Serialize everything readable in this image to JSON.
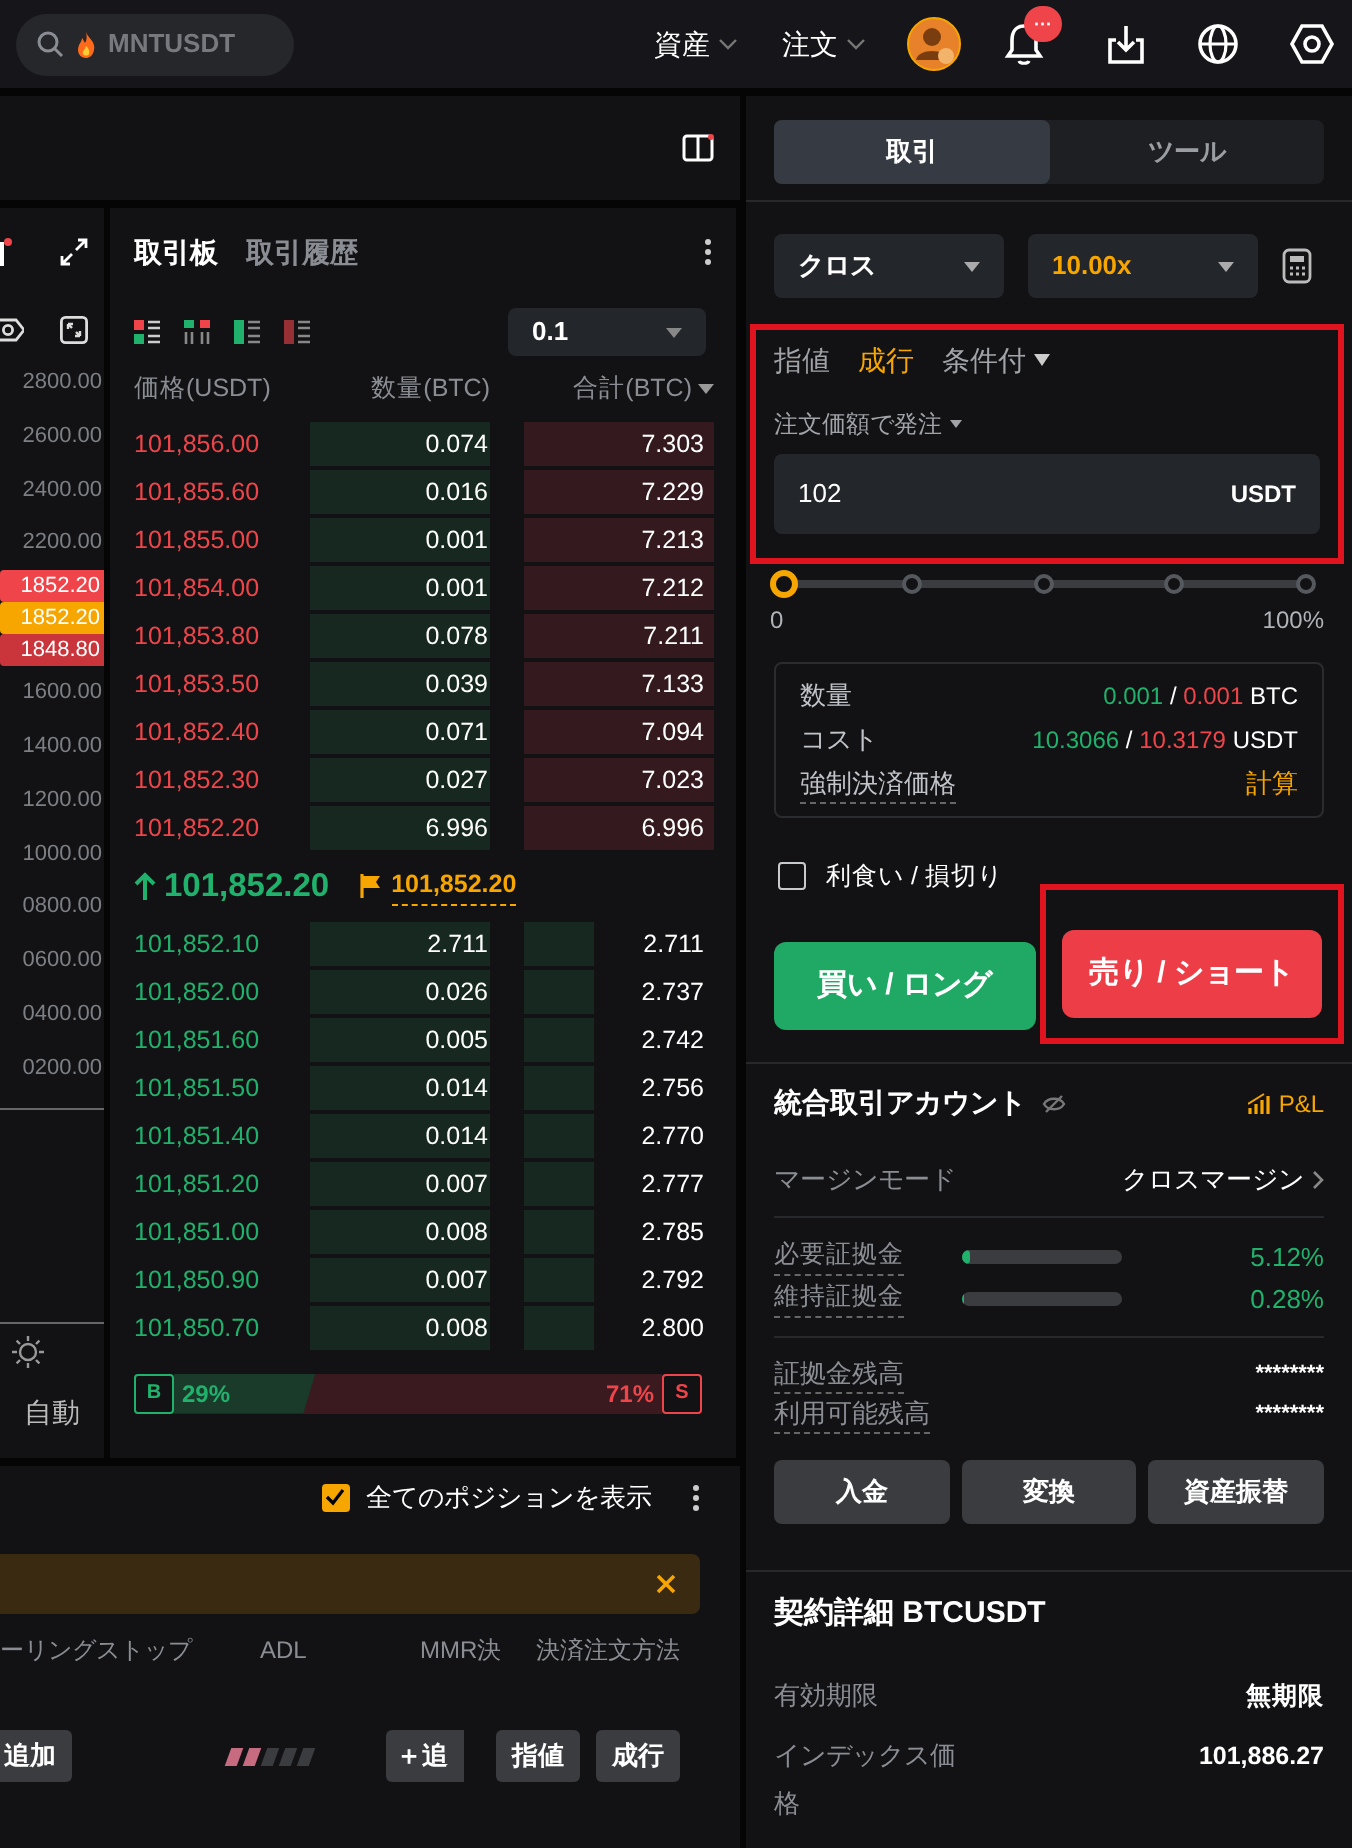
{
  "top_bar": {
    "search": {
      "placeholder": "MNTUSDT"
    },
    "menus": [
      {
        "label": "資産"
      },
      {
        "label": "注文"
      }
    ],
    "notification_badge": "···"
  },
  "chart": {
    "axis_labels": [
      {
        "kind": "tick",
        "text": "2800.00"
      },
      {
        "kind": "tick",
        "text": "2600.00"
      },
      {
        "kind": "tick",
        "text": "2400.00"
      },
      {
        "kind": "tick",
        "text": "2200.00"
      },
      {
        "kind": "tag",
        "text": "1852.20",
        "color": "#ef454a"
      },
      {
        "kind": "tag",
        "text": "1852.20",
        "color": "#f7a600"
      },
      {
        "kind": "tag",
        "text": "1848.80",
        "color": "#c9353a"
      },
      {
        "kind": "tick",
        "text": "1600.00"
      },
      {
        "kind": "tick",
        "text": "1400.00"
      },
      {
        "kind": "tick",
        "text": "1200.00"
      },
      {
        "kind": "tick",
        "text": "1000.00"
      },
      {
        "kind": "tick",
        "text": "0800.00"
      },
      {
        "kind": "tick",
        "text": "0600.00"
      },
      {
        "kind": "tick",
        "text": "0400.00"
      },
      {
        "kind": "tick",
        "text": "0200.00"
      }
    ],
    "auto_label": "自動"
  },
  "order_book": {
    "tabs": [
      {
        "label": "取引板",
        "selected": true
      },
      {
        "label": "取引履歴",
        "selected": false
      }
    ],
    "precision": "0.1",
    "columns": [
      "価格(USDT)",
      "数量(BTC)",
      "合計(BTC)"
    ],
    "asks": [
      {
        "price": "101,856.00",
        "quantity": "0.074",
        "total": "7.303"
      },
      {
        "price": "101,855.60",
        "quantity": "0.016",
        "total": "7.229"
      },
      {
        "price": "101,855.00",
        "quantity": "0.001",
        "total": "7.213"
      },
      {
        "price": "101,854.00",
        "quantity": "0.001",
        "total": "7.212"
      },
      {
        "price": "101,853.80",
        "quantity": "0.078",
        "total": "7.211"
      },
      {
        "price": "101,853.50",
        "quantity": "0.039",
        "total": "7.133"
      },
      {
        "price": "101,852.40",
        "quantity": "0.071",
        "total": "7.094"
      },
      {
        "price": "101,852.30",
        "quantity": "0.027",
        "total": "7.023"
      },
      {
        "price": "101,852.20",
        "quantity": "6.996",
        "total": "6.996"
      }
    ],
    "last_price": "101,852.20",
    "mark_price": "101,852.20",
    "bids": [
      {
        "price": "101,852.10",
        "quantity": "2.711",
        "total": "2.711"
      },
      {
        "price": "101,852.00",
        "quantity": "0.026",
        "total": "2.737"
      },
      {
        "price": "101,851.60",
        "quantity": "0.005",
        "total": "2.742"
      },
      {
        "price": "101,851.50",
        "quantity": "0.014",
        "total": "2.756"
      },
      {
        "price": "101,851.40",
        "quantity": "0.014",
        "total": "2.770"
      },
      {
        "price": "101,851.20",
        "quantity": "0.007",
        "total": "2.777"
      },
      {
        "price": "101,851.00",
        "quantity": "0.008",
        "total": "2.785"
      },
      {
        "price": "101,850.90",
        "quantity": "0.007",
        "total": "2.792"
      },
      {
        "price": "101,850.70",
        "quantity": "0.008",
        "total": "2.800"
      }
    ],
    "buy_badge": "B",
    "buy_ratio": {
      "label": "29%",
      "level": 0.29
    },
    "sell_ratio": "71%",
    "sell_badge": "S"
  },
  "positions": {
    "show_all": {
      "label": "全てのポジションを表示",
      "checked": true
    },
    "columns": [
      "ーリングストップ",
      "ADL",
      "MMR決",
      "決済注文方法"
    ],
    "row": {
      "add_button": "追加",
      "adl": {
        "level": 0.4
      },
      "mmr_button": "＋追",
      "close_buttons": [
        "指値",
        "成行"
      ]
    }
  },
  "trade_panel": {
    "tabs": [
      {
        "label": "取引",
        "selected": true
      },
      {
        "label": "ツール",
        "selected": false
      }
    ],
    "margin_select": "クロス",
    "leverage_select": "10.00x",
    "order_form": {
      "highlighted": true,
      "order_types": [
        {
          "label": "指値",
          "selected": false,
          "dropdown": false
        },
        {
          "label": "成行",
          "selected": true,
          "dropdown": false
        },
        {
          "label": "条件付",
          "selected": false,
          "dropdown": true
        }
      ],
      "order_by": "注文価額で発注",
      "amount": {
        "value": "102",
        "unit": "USDT"
      }
    },
    "slider": {
      "level": 0,
      "min_label": "0",
      "max_label": "100%"
    },
    "summary": [
      {
        "kind": "pair",
        "label": "数量",
        "buy": "0.001",
        "separator": "/",
        "sell": "0.001",
        "unit": "BTC"
      },
      {
        "kind": "pair",
        "label": "コスト",
        "buy": "10.3066",
        "separator": "/",
        "sell": "10.3179",
        "unit": "USDT"
      },
      {
        "kind": "link",
        "label": "強制決済価格",
        "value": "計算"
      }
    ],
    "tp_sl": {
      "label": "利食い / 損切り",
      "checked": false
    },
    "buy_button": {
      "label": "買い / ロング"
    },
    "sell_button": {
      "label": "売り / ショート",
      "highlighted": true
    }
  },
  "account": {
    "title": "統合取引アカウント",
    "pnl": "P&L",
    "margin_mode": {
      "label": "マージンモード",
      "value": "クロスマージン"
    },
    "margins": [
      {
        "label": "必要証拠金",
        "level": 0.0512,
        "value": "5.12%"
      },
      {
        "label": "維持証拠金",
        "level": 0.0028,
        "value": "0.28%"
      }
    ],
    "balances": [
      {
        "label": "証拠金残高",
        "value": "********"
      },
      {
        "label": "利用可能残高",
        "value": "********"
      }
    ],
    "buttons": [
      "入金",
      "変換",
      "資産振替"
    ]
  },
  "contract": {
    "title": "契約詳細 BTCUSDT",
    "rows": [
      {
        "label": "有効期限",
        "value": "無期限"
      },
      {
        "label": "インデックス価格",
        "value": "101,886.27"
      }
    ]
  }
}
